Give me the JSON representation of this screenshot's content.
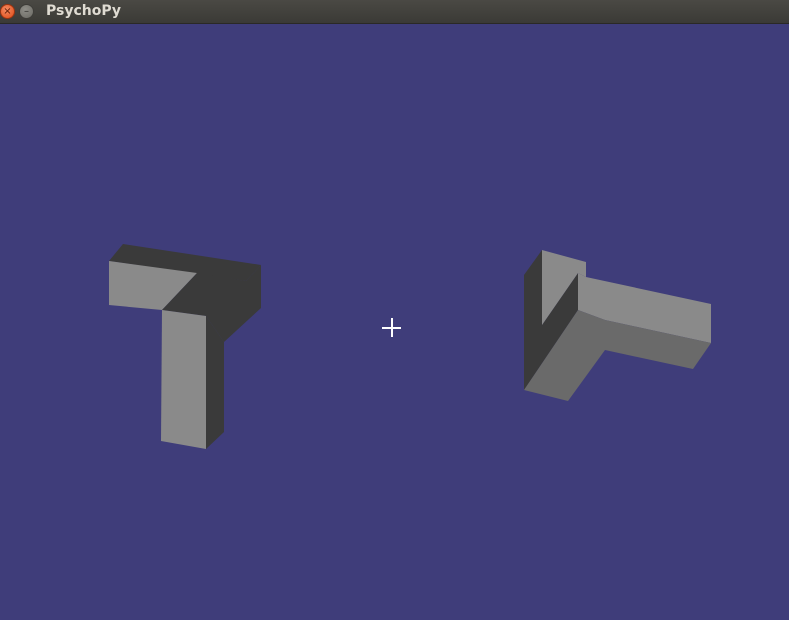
{
  "window": {
    "title": "PsychoPy",
    "close_glyph": "×",
    "minimize_glyph": "–"
  },
  "stage": {
    "background_color": "#3f3d7a",
    "fixation_cross_color": "#ffffff",
    "stimuli": [
      {
        "name": "left-block-figure",
        "colors": {
          "light": "#8a8a8a",
          "mid": "#6a6a6a",
          "dark": "#3a3a3a"
        }
      },
      {
        "name": "right-block-figure",
        "colors": {
          "light": "#8a8a8a",
          "mid": "#6a6a6a",
          "dark": "#3a3a3a"
        }
      }
    ]
  }
}
